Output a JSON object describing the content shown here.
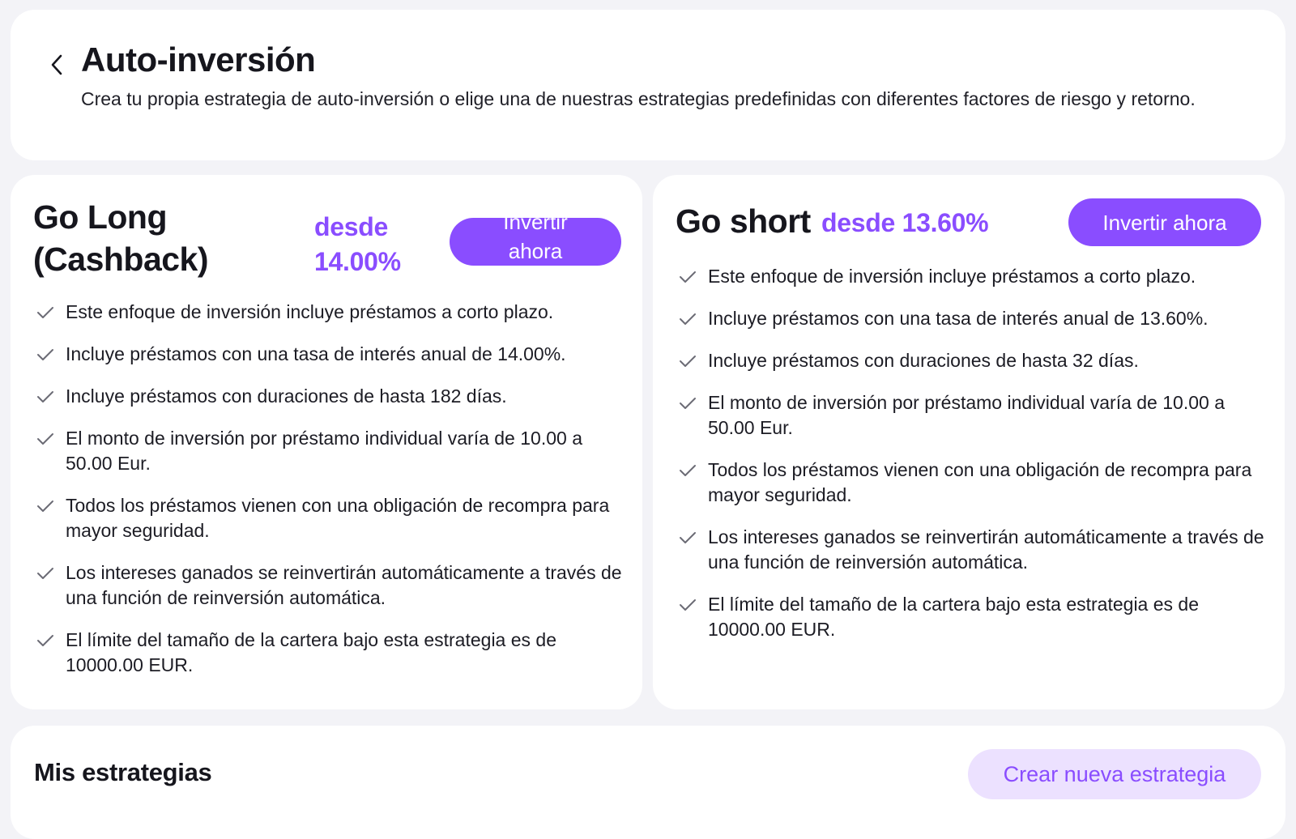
{
  "header": {
    "title": "Auto-inversión",
    "description": "Crea tu propia estrategia de auto-inversión o elige una de nuestras estrategias predefinidas con diferentes factores de riesgo y retorno.",
    "back_icon": "chevron-left-icon"
  },
  "strategies": [
    {
      "title": "Go Long (Cashback)",
      "title_line1": "Go Long",
      "title_line2": "(Cashback)",
      "rate_label": "desde",
      "rate_value": "14.00%",
      "button_label": "Invertir ahora",
      "button_line1": "Invertir",
      "button_line2": "ahora",
      "features": [
        "Este enfoque de inversión incluye préstamos a corto plazo.",
        "Incluye préstamos con una tasa de interés anual de 14.00%.",
        "Incluye préstamos con duraciones de hasta 182 días.",
        "El monto de inversión por préstamo individual varía de 10.00 a 50.00 Eur.",
        "Todos los préstamos vienen con una obligación de recompra para mayor seguridad.",
        "Los intereses ganados se reinvertirán automáticamente a través de una función de reinversión automática.",
        "El límite del tamaño de la cartera bajo esta estrategia es de 10000.00 EUR."
      ]
    },
    {
      "title": "Go short",
      "rate_text": "desde 13.60%",
      "button_label": "Invertir ahora",
      "features": [
        "Este enfoque de inversión incluye préstamos a corto plazo.",
        "Incluye préstamos con una tasa de interés anual de 13.60%.",
        "Incluye préstamos con duraciones de hasta 32 días.",
        "El monto de inversión por préstamo individual varía de 10.00 a 50.00 Eur.",
        "Todos los préstamos vienen con una obligación de recompra para mayor seguridad.",
        "Los intereses ganados se reinvertirán automáticamente a través de una función de reinversión automática.",
        "El límite del tamaño de la cartera bajo esta estrategia es de 10000.00 EUR."
      ]
    }
  ],
  "my_strategies": {
    "title": "Mis estrategias",
    "create_button": "Crear nueva estrategia"
  },
  "colors": {
    "accent": "#8a4dff",
    "accent_light": "#ece1ff",
    "background": "#f3f3f7",
    "card": "#ffffff",
    "check": "#6b6b75"
  }
}
